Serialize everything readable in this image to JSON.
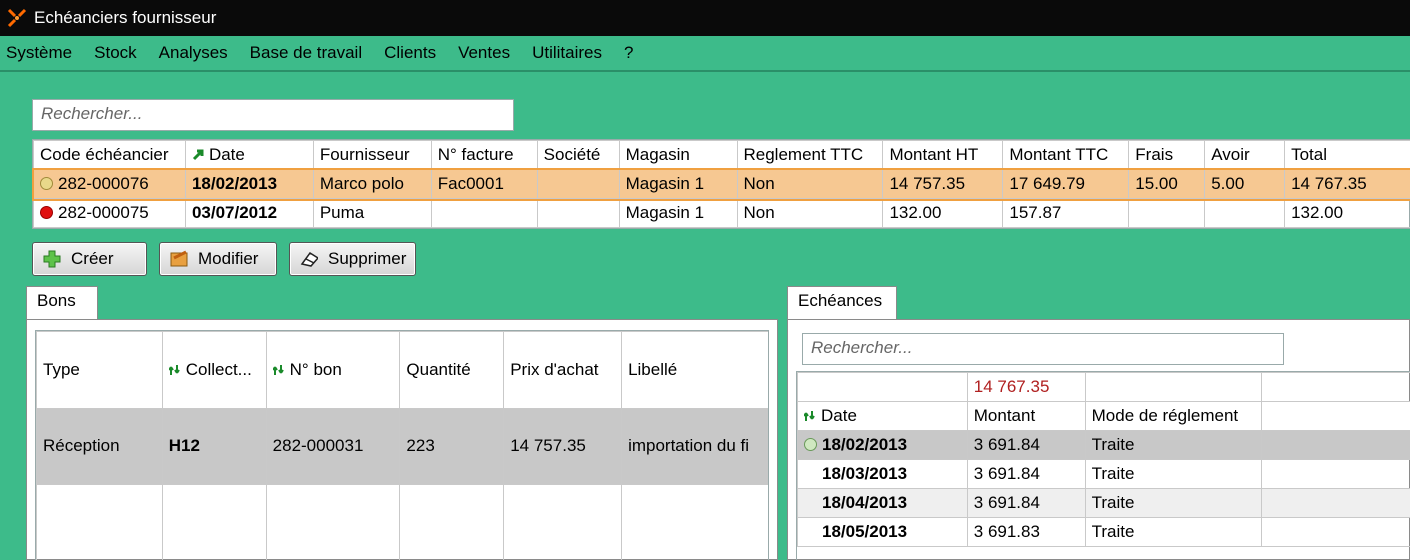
{
  "window": {
    "title": "Echéanciers fournisseur"
  },
  "menu": [
    "Système",
    "Stock",
    "Analyses",
    "Base de travail",
    "Clients",
    "Ventes",
    "Utilitaires",
    "?"
  ],
  "search": {
    "placeholder": "Rechercher..."
  },
  "main_table": {
    "columns": [
      "Code échéancier",
      "Date",
      "Fournisseur",
      "N° facture",
      "Société",
      "Magasin",
      "Reglement TTC",
      "Montant HT",
      "Montant TTC",
      "Frais",
      "Avoir",
      "Total"
    ],
    "rows": [
      {
        "status": "yellow",
        "cells": [
          "282-000076",
          "18/02/2013",
          "Marco polo",
          "Fac0001",
          "",
          "Magasin 1",
          "Non",
          "14 757.35",
          "17 649.79",
          "15.00",
          "5.00",
          "14 767.35"
        ]
      },
      {
        "status": "red",
        "cells": [
          "282-000075",
          "03/07/2012",
          "Puma",
          "",
          "",
          "Magasin 1",
          "Non",
          "132.00",
          "157.87",
          "",
          "",
          "132.00"
        ]
      }
    ]
  },
  "buttons": {
    "create": "Créer",
    "modify": "Modifier",
    "delete": "Supprimer"
  },
  "bons": {
    "tab": "Bons",
    "columns": [
      "Type",
      "Collect...",
      "N° bon",
      "Quantité",
      "Prix d'achat",
      "Libellé"
    ],
    "rows": [
      [
        "Réception",
        "H12",
        "282-000031",
        "223",
        "14 757.35",
        "importation du fi"
      ]
    ]
  },
  "echeances": {
    "tab": "Echéances",
    "search_placeholder": "Rechercher...",
    "total": "14 767.35",
    "columns": [
      "Date",
      "Montant",
      "Mode de réglement"
    ],
    "rows": [
      [
        "18/02/2013",
        "3 691.84",
        "Traite"
      ],
      [
        "18/03/2013",
        "3 691.84",
        "Traite"
      ],
      [
        "18/04/2013",
        "3 691.84",
        "Traite"
      ],
      [
        "18/05/2013",
        "3 691.83",
        "Traite"
      ]
    ]
  }
}
